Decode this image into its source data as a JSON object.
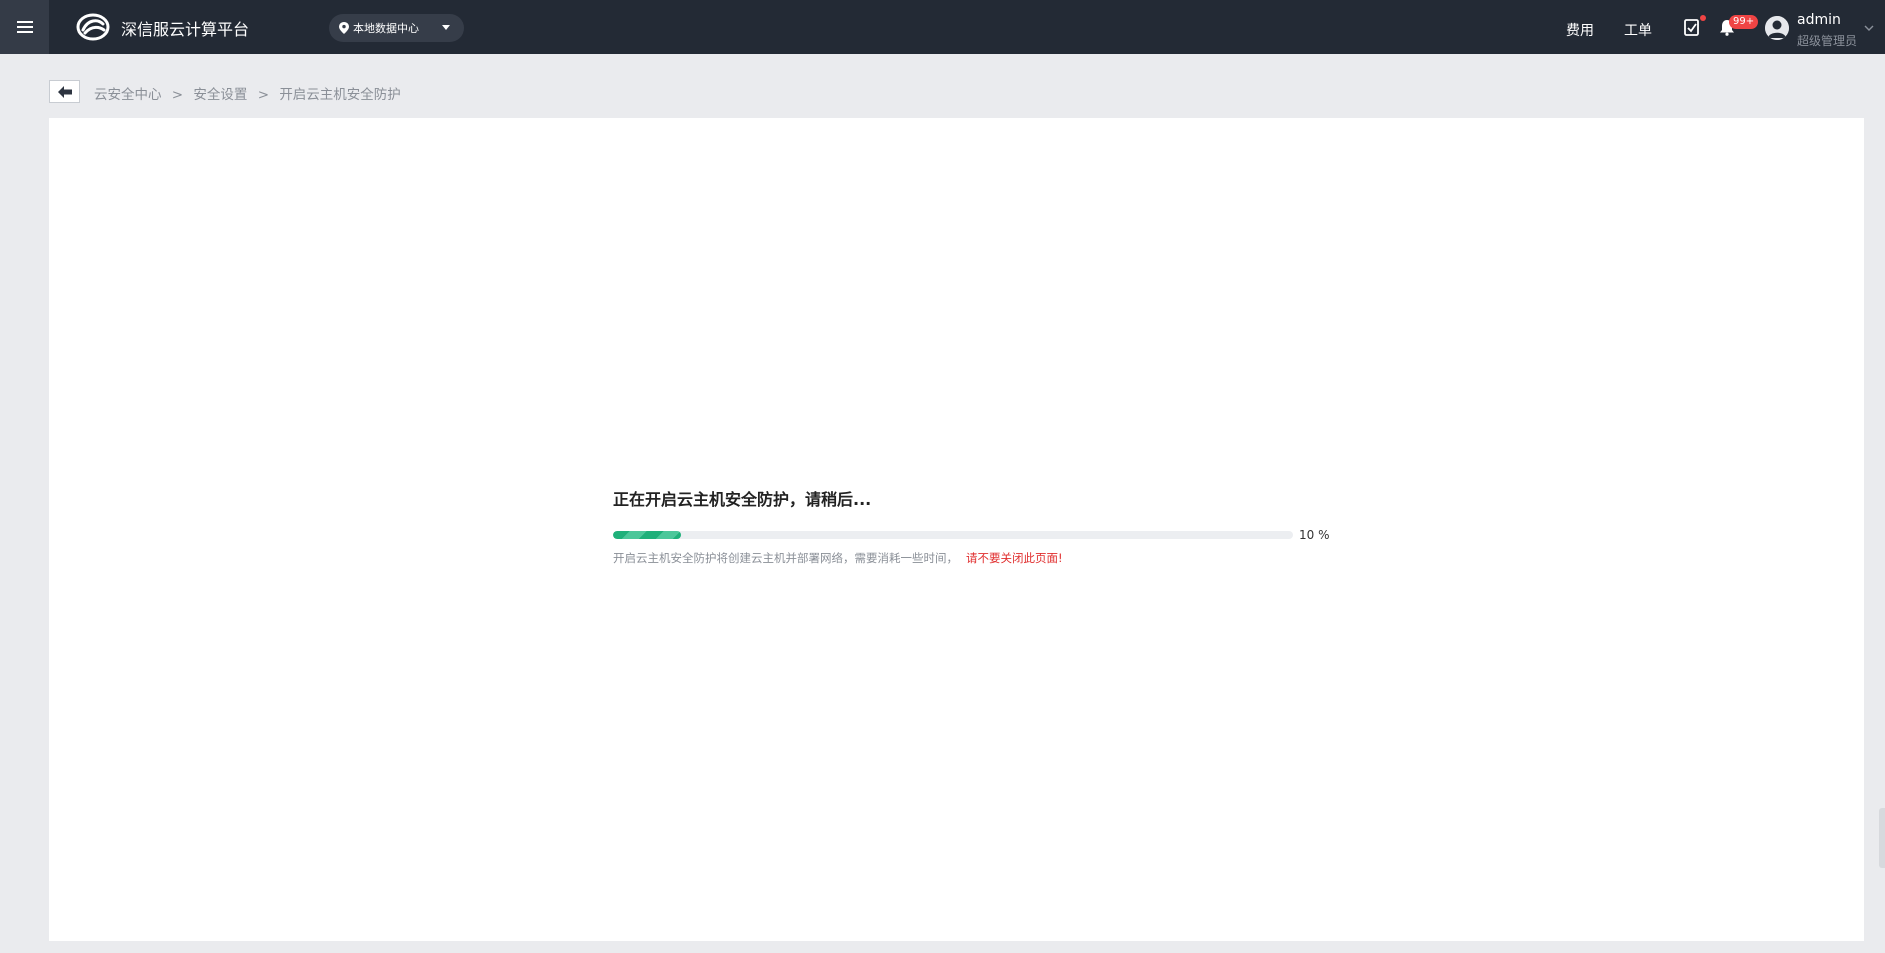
{
  "header": {
    "app_title": "深信服云计算平台",
    "datacenter": "本地数据中心",
    "links": {
      "fees": "费用",
      "tickets": "工单"
    },
    "notification_badge": "99+",
    "user": {
      "name": "admin",
      "role": "超级管理员"
    },
    "colors": {
      "bar": "#232a35",
      "badge": "#f04444"
    }
  },
  "breadcrumb": {
    "items": [
      "云安全中心",
      "安全设置",
      "开启云主机安全防护"
    ],
    "separator": ">"
  },
  "progress": {
    "title": "正在开启云主机安全防护，请稍后...",
    "percent": 10,
    "percent_label": "10 %",
    "note": "开启云主机安全防护将创建云主机并部署网络，需要消耗一些时间，",
    "warning": "请不要关闭此页面!",
    "colors": {
      "fill": "#1fb07a",
      "warning": "#e02d2d"
    }
  }
}
